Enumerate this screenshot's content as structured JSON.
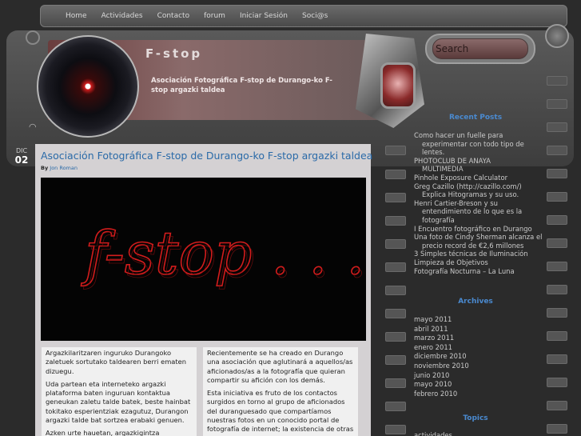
{
  "nav": [
    "Home",
    "Actividades",
    "Contacto",
    "forum",
    "Iniciar Sesión",
    "Soci@s"
  ],
  "header": {
    "title": "F-stop",
    "description": "Asociación Fotográfica F-stop de Durango-ko F-stop argazki taldea"
  },
  "search": {
    "placeholder": "Search"
  },
  "post": {
    "date_month": "DIC",
    "date_day": "02",
    "title": "Asociación Fotográfica F-stop de Durango-ko F-stop argazki taldea",
    "by_label": "By",
    "author": "Jon Roman",
    "image_text": "f-stop . . .",
    "col1": [
      "Argazkilaritzaren inguruko Durangoko zaletuek sortutako taldearen berri ematen dizuegu.",
      "Uda partean eta interneteko argazki plataforma baten inguruan kontaktua geneukan zaletu talde batek, beste hainbat tokitako esperientziak ezagutuz, Durangon argazki talde bat sortzea erabaki genuen.",
      "Azken urte hauetan, argazkigintza tradizionalaren beherakadaren ostean eta aro"
    ],
    "col2": [
      "Recientemente se ha creado en Durango una asociación que aglutinará a aquellos/as aficionados/as a la fotografía que quieran compartir su afición con los demás.",
      "Esta iniciativa es fruto de los contactos surgidos en torno al grupo de aficionados del duranguesado que compartíamos nuestras fotos en un conocido portal de fotografía de internet; la existencia de otras experiencias similares en"
    ]
  },
  "sidebar": {
    "recent_title": "Recent Posts",
    "recent": [
      {
        "text": "Como hacer un fuelle para",
        "indent": false
      },
      {
        "text": "experimentar con todo tipo de",
        "indent": true
      },
      {
        "text": "lentes.",
        "indent": true
      },
      {
        "text": "PHOTOCLUB DE ANAYA",
        "indent": false
      },
      {
        "text": "MULTIMEDIA",
        "indent": true
      },
      {
        "text": "Pinhole Exposure Calculator",
        "indent": false
      },
      {
        "text": "Greg Cazillo (http://cazillo.com/)",
        "indent": false
      },
      {
        "text": "Explica Hitogramas y su uso.",
        "indent": true
      },
      {
        "text": "Henri Cartier-Breson y su",
        "indent": false
      },
      {
        "text": "entendimiento de lo que es la",
        "indent": true
      },
      {
        "text": "fotografía",
        "indent": true
      },
      {
        "text": "I Encuentro fotográfico en Durango",
        "indent": false
      },
      {
        "text": "Una foto de Cindy Sherman alcanza el",
        "indent": false
      },
      {
        "text": "precio record de €2,6 millones",
        "indent": true
      },
      {
        "text": "3 Simples técnicas de Iluminación",
        "indent": false
      },
      {
        "text": "Limpieza de Objetivos",
        "indent": false
      },
      {
        "text": "Fotografía Nocturna – La Luna",
        "indent": false
      }
    ],
    "archives_title": "Archives",
    "archives": [
      "mayo 2011",
      "abril 2011",
      "marzo 2011",
      "enero 2011",
      "diciembre 2010",
      "noviembre 2010",
      "junio 2010",
      "mayo 2010",
      "febrero 2010"
    ],
    "topics_title": "Topics",
    "topics": [
      "actividades"
    ]
  },
  "colors": {
    "link": "#2a6aa8",
    "sidebar_heading": "#4a8ad0",
    "light_trail": "#d21c1c"
  },
  "icons": [
    "rss-icon",
    "gear-icon",
    "search-knob-icon"
  ]
}
